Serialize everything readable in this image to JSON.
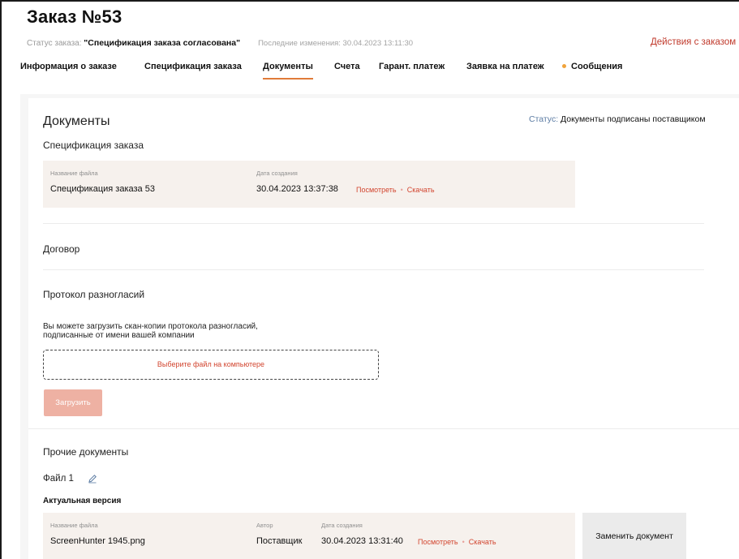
{
  "order": {
    "title": "Заказ №53",
    "status_label": "Статус заказа: ",
    "status_value": "\"Спецификация заказа согласована\"",
    "last_changes": "Последние изменения: 30.04.2023 13:11:30",
    "actions_link": "Действия с заказом"
  },
  "tabs": [
    {
      "label": "Информация о заказе"
    },
    {
      "label": "Спецификация заказа"
    },
    {
      "label": "Документы",
      "active": true
    },
    {
      "label": "Счета"
    },
    {
      "label": "Гарант. платеж"
    },
    {
      "label": "Заявка на платеж"
    },
    {
      "label": "Сообщения",
      "indicator_color": "#f0a33b"
    }
  ],
  "documents": {
    "title": "Документы",
    "status_label": "Статус:",
    "status_value": " Документы подписаны поставщиком",
    "specification": {
      "heading": "Спецификация заказа",
      "col_filename": "Название файла",
      "col_created": "Дата создания",
      "filename": "Спецификация заказа 53",
      "created": "30.04.2023 13:37:38",
      "view_link": "Посмотреть",
      "download_link": "Скачать"
    },
    "contract": {
      "heading": "Договор"
    },
    "protocol": {
      "heading": "Протокол разногласий",
      "hint_line1": "Вы можете загрузить скан-копии протокола разногласий,",
      "hint_line2": "подписанные от имени вашей компании",
      "dropzone_label": "Выберите файл на компьютере",
      "upload_button": "Загрузить"
    },
    "other": {
      "heading": "Прочие документы",
      "file_name": "Файл 1",
      "version_label": "Актуальная версия",
      "col_filename": "Название файла",
      "col_author": "Автор",
      "col_created": "Дата создания",
      "filename": "ScreenHunter 1945.png",
      "author": "Поставщик",
      "created": "30.04.2023 13:31:40",
      "view_link": "Посмотреть",
      "download_link": "Скачать",
      "replace_button": "Заменить документ"
    }
  },
  "colors": {
    "accent": "#e07b39",
    "link": "#d2452f",
    "status_blue": "#5b7ba3",
    "file_box_bg": "#f6f1ed",
    "upload_button_bg": "#eeb1a3",
    "message_dot": "#f0a33b"
  },
  "icons": {
    "edit": "pencil-icon"
  }
}
